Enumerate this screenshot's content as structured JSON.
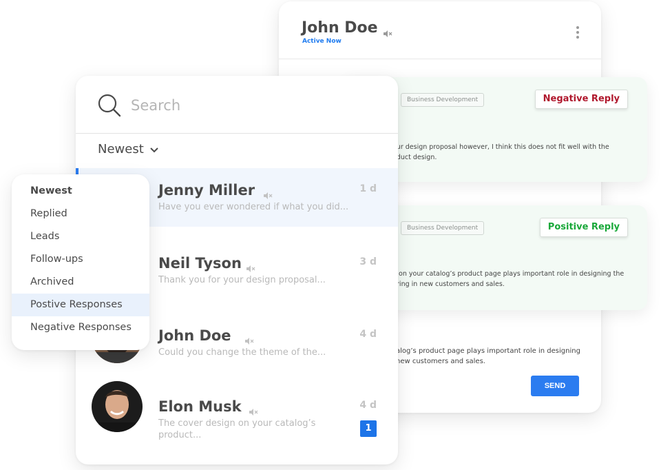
{
  "chat": {
    "name": "John Doe",
    "status": "Active Now",
    "compose_text": "alog’s product page plays important role in designing\nnew customers and sales.",
    "send_label": "SEND"
  },
  "replies": [
    {
      "tag": "Business Development",
      "badge": "Negative Reply",
      "message": "our design proposal however, I think this does not fit well with the\noduct design."
    },
    {
      "tag": "Business Development",
      "badge": "Positive Reply",
      "message": "n on your catalog’s product page plays important role in designing the\nbring in new customers and sales."
    }
  ],
  "inbox": {
    "search_placeholder": "Search",
    "sort_label": "Newest",
    "conversations": [
      {
        "name": "Jenny Miller",
        "preview": "Have you ever wondered if what you did...",
        "time": "1 d",
        "active": true
      },
      {
        "name": "Neil Tyson",
        "preview": "Thank you for your design proposal...",
        "time": "3 d"
      },
      {
        "name": "John Doe",
        "preview": "Could you change the theme of the...",
        "time": "4 d"
      },
      {
        "name": "Elon Musk",
        "preview": "The cover design on your catalog’s product...",
        "time": "4 d",
        "unread": "1"
      }
    ]
  },
  "filter_menu": {
    "options": [
      "Newest",
      "Replied",
      "Leads",
      "Follow-ups",
      "Archived",
      "Postive Responses",
      "Negative Responses"
    ],
    "selected": "Newest",
    "highlighted": "Postive Responses"
  },
  "colors": {
    "accent": "#2b7cf0",
    "negative": "#b0182d",
    "positive": "#1aa83a",
    "reply_bg": "#f3faf5"
  }
}
